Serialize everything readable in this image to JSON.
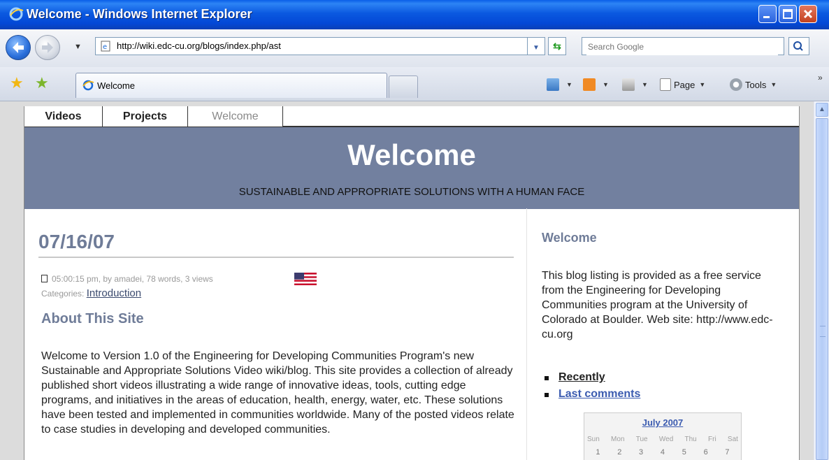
{
  "window": {
    "title": "Welcome - Windows Internet Explorer"
  },
  "address_bar": {
    "url": "http://wiki.edc-cu.org/blogs/index.php/ast"
  },
  "search": {
    "placeholder": "Search Google"
  },
  "tab": {
    "label": "Welcome"
  },
  "command_bar": {
    "page_label": "Page",
    "tools_label": "Tools",
    "overflow": "»"
  },
  "site": {
    "nav": [
      "Videos",
      "Projects",
      "Welcome"
    ],
    "banner_title": "Welcome",
    "tagline": "SUSTAINABLE AND APPROPRIATE SOLUTIONS WITH A HUMAN FACE"
  },
  "post": {
    "date": "07/16/07",
    "meta": "05:00:15 pm, by amadei, 78 words, 3 views",
    "categories_label": "Categories:",
    "category": "Introduction",
    "heading": "About This Site",
    "body": "Welcome to Version 1.0 of the Engineering for Developing Communities Program's new Sustainable and Appropriate Solutions Video wiki/blog. This site provides a collection of already published short videos illustrating a wide range of innovative ideas, tools, cutting edge programs, and initiatives in the areas of education, health, energy, water, etc. These solutions have been tested and implemented in communities worldwide. Many of the posted videos relate to case studies in developing and developed communities."
  },
  "sidebar": {
    "heading": "Welcome",
    "text": "This blog listing is provided as a free service from the Engineering for Developing Communities program at the University of Colorado at Boulder. Web site: http://www.edc-cu.org",
    "links": [
      "Recently",
      "Last comments"
    ]
  },
  "calendar": {
    "month": "July 2007",
    "days": [
      "Sun",
      "Mon",
      "Tue",
      "Wed",
      "Thu",
      "Fri",
      "Sat"
    ],
    "first_week": [
      "1",
      "2",
      "3",
      "4",
      "5",
      "6",
      "7"
    ]
  }
}
